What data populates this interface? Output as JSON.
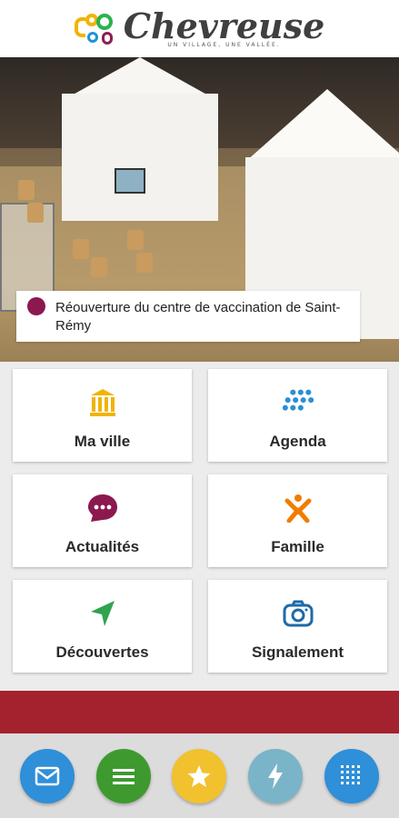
{
  "header": {
    "brand": "Chevreuse",
    "tagline": "UN VILLAGE, UNE VALLÉE."
  },
  "hero": {
    "caption": "Réouverture du centre de vaccination de Saint-Rémy"
  },
  "tiles": [
    {
      "label": "Ma ville",
      "icon": "town-hall-icon",
      "color": "#f0b400"
    },
    {
      "label": "Agenda",
      "icon": "dots-grid-icon",
      "color": "#2a8fd6"
    },
    {
      "label": "Actualités",
      "icon": "chat-bubble-icon",
      "color": "#8c1850"
    },
    {
      "label": "Famille",
      "icon": "person-icon",
      "color": "#f07d00"
    },
    {
      "label": "Découvertes",
      "icon": "navigation-arrow-icon",
      "color": "#2ea44f"
    },
    {
      "label": "Signalement",
      "icon": "camera-icon",
      "color": "#1e6aa8"
    }
  ],
  "bottom_nav": [
    {
      "icon": "mail-icon",
      "color": "#2f8fd8"
    },
    {
      "icon": "menu-icon",
      "color": "#3e9a2f"
    },
    {
      "icon": "star-icon",
      "color": "#f2c12e"
    },
    {
      "icon": "lightning-icon",
      "color": "#7ab4c8"
    },
    {
      "icon": "grid-icon",
      "color": "#2f8fd8"
    }
  ],
  "colors": {
    "accent_red": "#a4212e",
    "caption_dot": "#8c1850"
  }
}
